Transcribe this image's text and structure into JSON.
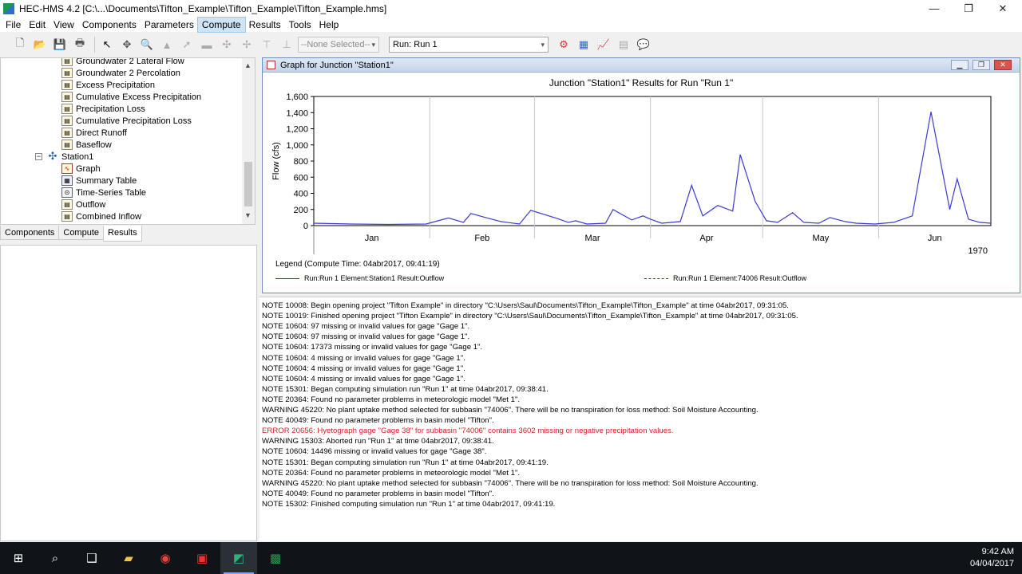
{
  "window": {
    "title": "HEC-HMS 4.2 [C:\\...\\Documents\\Tifton_Example\\Tifton_Example\\Tifton_Example.hms]",
    "minimize": "—",
    "maximize": "❐",
    "close": "✕"
  },
  "menu": [
    "File",
    "Edit",
    "View",
    "Components",
    "Parameters",
    "Compute",
    "Results",
    "Tools",
    "Help"
  ],
  "toolbar": {
    "none_selected": "--None Selected--",
    "run_select": "Run: Run 1"
  },
  "tree": {
    "items": [
      {
        "label": "Groundwater 2 Lateral Flow",
        "icon": "folder-icon"
      },
      {
        "label": "Groundwater 2 Percolation",
        "icon": "folder-icon"
      },
      {
        "label": "Excess Precipitation",
        "icon": "folder-icon"
      },
      {
        "label": "Cumulative Excess Precipitation",
        "icon": "folder-icon"
      },
      {
        "label": "Precipitation Loss",
        "icon": "folder-icon"
      },
      {
        "label": "Cumulative Precipitation Loss",
        "icon": "folder-icon"
      },
      {
        "label": "Direct Runoff",
        "icon": "folder-icon"
      },
      {
        "label": "Baseflow",
        "icon": "folder-icon"
      }
    ],
    "station": {
      "label": "Station1",
      "expander": "−"
    },
    "station_items": [
      {
        "label": "Graph",
        "icon": "graph-icon"
      },
      {
        "label": "Summary Table",
        "icon": "table-icon"
      },
      {
        "label": "Time-Series Table",
        "icon": "timeseries-icon"
      },
      {
        "label": "Outflow",
        "icon": "folder-icon"
      },
      {
        "label": "Combined Inflow",
        "icon": "folder-icon"
      }
    ]
  },
  "tabs": [
    "Components",
    "Compute",
    "Results"
  ],
  "graph_window": {
    "title": "Graph for Junction \"Station1\""
  },
  "chart_data": {
    "type": "line",
    "title": "Junction \"Station1\" Results for Run \"Run 1\"",
    "ylabel": "Flow (cfs)",
    "xlabel": "",
    "year_label": "1970",
    "ylim": [
      0,
      1600
    ],
    "yticks": [
      "0",
      "200",
      "400",
      "600",
      "800",
      "1,000",
      "1,200",
      "1,400",
      "1,600"
    ],
    "x_categories": [
      "Jan",
      "Feb",
      "Mar",
      "Apr",
      "May",
      "Jun"
    ],
    "grid": true,
    "legend_heading": "Legend (Compute Time: 04abr2017, 09:41:19)",
    "series": [
      {
        "name": "Run:Run 1 Element:Station1 Result:Outflow",
        "style": "solid",
        "color": "#3a3ad0",
        "x_day": [
          0,
          10,
          20,
          30,
          36,
          40,
          42,
          46,
          50,
          55,
          58,
          65,
          68,
          70,
          73,
          78,
          80,
          85,
          88,
          90,
          93,
          98,
          101,
          104,
          108,
          112,
          114,
          118,
          121,
          124,
          128,
          131,
          135,
          138,
          142,
          145,
          150,
          155,
          160,
          165,
          170,
          172,
          175,
          178,
          181
        ],
        "values": [
          30,
          20,
          15,
          20,
          95,
          40,
          150,
          100,
          50,
          20,
          190,
          90,
          40,
          60,
          20,
          30,
          200,
          70,
          120,
          80,
          30,
          50,
          500,
          120,
          250,
          180,
          880,
          300,
          60,
          40,
          160,
          40,
          30,
          100,
          50,
          30,
          20,
          40,
          120,
          1410,
          200,
          580,
          80,
          40,
          30
        ]
      },
      {
        "name": "Run:Run 1 Element:74006 Result:Outflow",
        "style": "dashed",
        "color": "#3a3ad0"
      }
    ]
  },
  "log": [
    {
      "text": "NOTE 10008:  Begin opening project \"Tifton Example\" in directory \"C:\\Users\\Saul\\Documents\\Tifton_Example\\Tifton_Example\" at time 04abr2017, 09:31:05.",
      "level": "note"
    },
    {
      "text": "NOTE 10019:  Finished opening project \"Tifton Example\" in directory \"C:\\Users\\Saul\\Documents\\Tifton_Example\\Tifton_Example\" at time 04abr2017, 09:31:05.",
      "level": "note"
    },
    {
      "text": "NOTE 10604:  97 missing or invalid values for gage \"Gage 1\".",
      "level": "note"
    },
    {
      "text": "NOTE 10604:  97 missing or invalid values for gage \"Gage 1\".",
      "level": "note"
    },
    {
      "text": "NOTE 10604:  17373 missing or invalid values for gage \"Gage 1\".",
      "level": "note"
    },
    {
      "text": "NOTE 10604:  4 missing or invalid values for gage \"Gage 1\".",
      "level": "note"
    },
    {
      "text": "NOTE 10604:  4 missing or invalid values for gage \"Gage 1\".",
      "level": "note"
    },
    {
      "text": "NOTE 10604:  4 missing or invalid values for gage \"Gage 1\".",
      "level": "note"
    },
    {
      "text": "NOTE 15301:  Began computing simulation run \"Run 1\" at time 04abr2017, 09:38:41.",
      "level": "note"
    },
    {
      "text": "NOTE 20364:  Found no parameter problems in meteorologic model \"Met 1\".",
      "level": "note"
    },
    {
      "text": "WARNING 45220:  No plant uptake method selected for subbasin \"74006\".  There will be no transpiration for loss method: Soil Moisture Accounting.",
      "level": "warning"
    },
    {
      "text": "NOTE 40049:  Found no parameter problems in basin model \"Tifton\".",
      "level": "note"
    },
    {
      "text": "ERROR 20656:  Hyetograph gage \"Gage 38\" for subbasin \"74006\" contains 3602 missing or negative precipitation values.",
      "level": "error"
    },
    {
      "text": "WARNING 15303:  Aborted run \"Run 1\" at time 04abr2017, 09:38:41.",
      "level": "warning"
    },
    {
      "text": "NOTE 10604:  14496 missing or invalid values for gage \"Gage 38\".",
      "level": "note"
    },
    {
      "text": "NOTE 15301:  Began computing simulation run \"Run 1\" at time 04abr2017, 09:41:19.",
      "level": "note"
    },
    {
      "text": "NOTE 20364:  Found no parameter problems in meteorologic model \"Met 1\".",
      "level": "note"
    },
    {
      "text": "WARNING 45220:  No plant uptake method selected for subbasin \"74006\".  There will be no transpiration for loss method: Soil Moisture Accounting.",
      "level": "warning"
    },
    {
      "text": "NOTE 40049:  Found no parameter problems in basin model \"Tifton\".",
      "level": "note"
    },
    {
      "text": "NOTE 15302:  Finished computing simulation run \"Run 1\" at time 04abr2017, 09:41:19.",
      "level": "note"
    }
  ],
  "taskbar": {
    "time": "9:42 AM",
    "date": "04/04/2017",
    "apps": [
      "windows-start-icon",
      "search-icon",
      "task-view-icon",
      "file-explorer-icon",
      "chrome-icon",
      "acrobat-icon",
      "hec-hms-icon",
      "excel-icon"
    ]
  }
}
